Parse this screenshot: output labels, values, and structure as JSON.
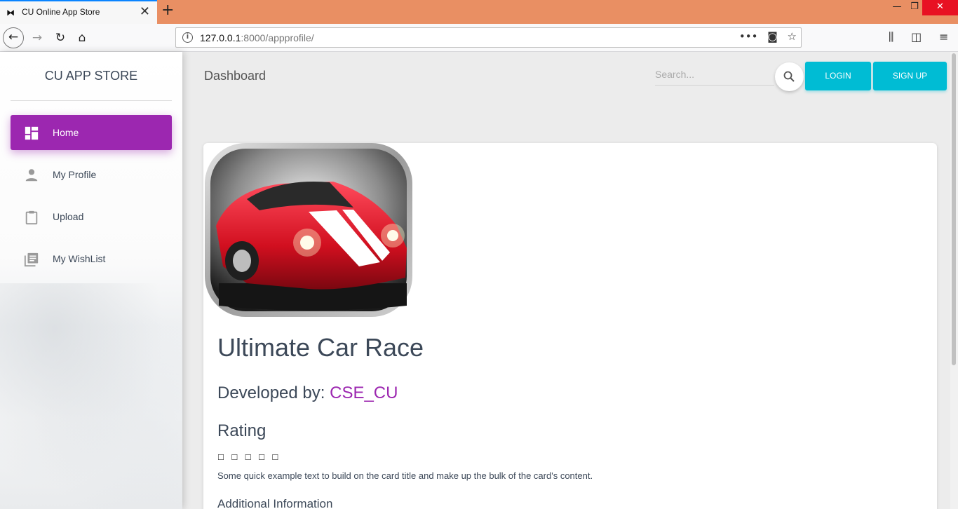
{
  "browser": {
    "tab_title": "CU Online App Store",
    "url_host": "127.0.0.1",
    "url_path": ":8000/appprofile/"
  },
  "sidebar": {
    "brand": "CU APP STORE",
    "items": [
      {
        "label": "Home",
        "icon": "dashboard-icon",
        "active": true
      },
      {
        "label": "My Profile",
        "icon": "person-icon",
        "active": false
      },
      {
        "label": "Upload",
        "icon": "clipboard-icon",
        "active": false
      },
      {
        "label": "My WishList",
        "icon": "library-books-icon",
        "active": false
      }
    ]
  },
  "header": {
    "title": "Dashboard",
    "search_placeholder": "Search...",
    "login_label": "LOGIN",
    "signup_label": "SIGN UP"
  },
  "app": {
    "name": "Ultimate Car Race",
    "developed_by_label": "Developed by:",
    "developer": "CSE_CU",
    "rating_title": "Rating",
    "stars_text": "☐ ☐ ☐ ☐ ☐",
    "description": "Some quick example text to build on the card title and make up the bulk of the card's content.",
    "additional_info_title": "Additional Information"
  },
  "colors": {
    "accent_purple": "#9c27b0",
    "button_cyan": "#00bcd4",
    "tabbar_orange": "#e98f63"
  }
}
